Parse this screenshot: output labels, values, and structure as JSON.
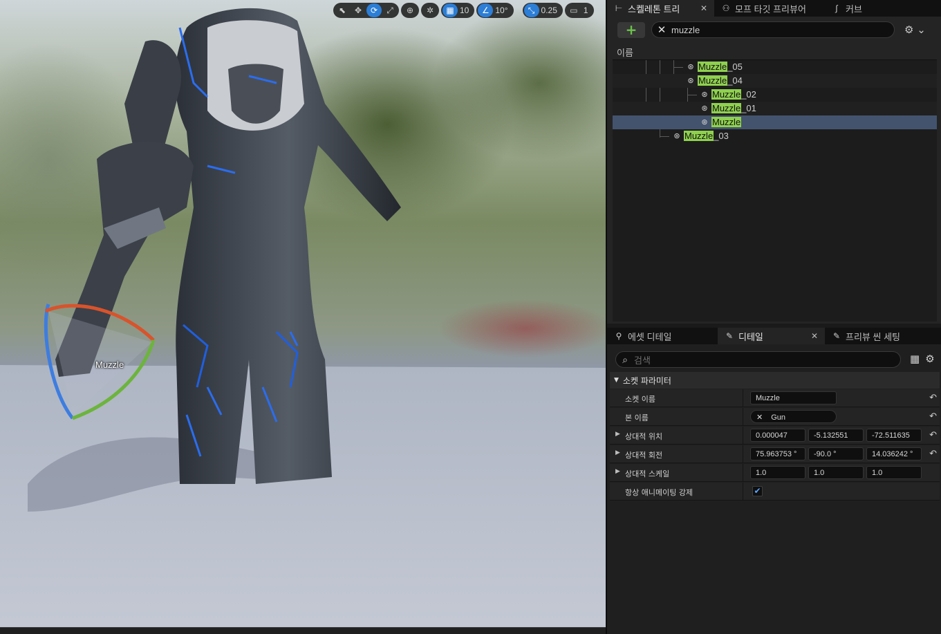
{
  "viewport": {
    "toolbar": {
      "grid_snap_value": "10",
      "rotation_snap_value": "10°",
      "scale_snap_value": "0.25",
      "camera_speed": "1"
    },
    "socket_label": "Muzzle"
  },
  "top_tabs": [
    {
      "label": "스켈레톤 트리",
      "icon": "skeleton-tree-icon"
    },
    {
      "label": "모프 타깃 프리뷰어",
      "icon": "morph-target-icon"
    },
    {
      "label": "커브",
      "icon": "curve-icon"
    }
  ],
  "skeleton_tree": {
    "search_value": "muzzle",
    "column_header": "이름",
    "rows": [
      {
        "match": "Muzzle",
        "suffix": "_05"
      },
      {
        "match": "Muzzle",
        "suffix": "_04"
      },
      {
        "match": "Muzzle",
        "suffix": "_02"
      },
      {
        "match": "Muzzle",
        "suffix": "_01"
      },
      {
        "match": "Muzzle",
        "suffix": ""
      },
      {
        "match": "Muzzle",
        "suffix": "_03"
      }
    ]
  },
  "details_tabs": [
    {
      "label": "에셋 디테일"
    },
    {
      "label": "디테일"
    },
    {
      "label": "프리뷰 씬 세팅"
    }
  ],
  "details": {
    "search_placeholder": "검색",
    "section_title": "소켓 파라미터",
    "socket_name_label": "소켓 이름",
    "socket_name_value": "Muzzle",
    "bone_name_label": "본 이름",
    "bone_name_value": "Gun",
    "rel_location_label": "상대적 위치",
    "rel_location": [
      "0.000047",
      "-5.132551",
      "-72.511635"
    ],
    "rel_rotation_label": "상대적 회전",
    "rel_rotation": [
      "75.963753 °",
      "-90.0 °",
      "14.036242 °"
    ],
    "rel_scale_label": "상대적 스케일",
    "rel_scale": [
      "1.0",
      "1.0",
      "1.0"
    ],
    "force_animate_label": "항상 애니메이팅 강제",
    "force_animate_checked": true
  },
  "colors": {
    "accent_blue": "#2c7ed6",
    "highlight_green": "#8fd14f",
    "selection_row": "#43536e"
  }
}
